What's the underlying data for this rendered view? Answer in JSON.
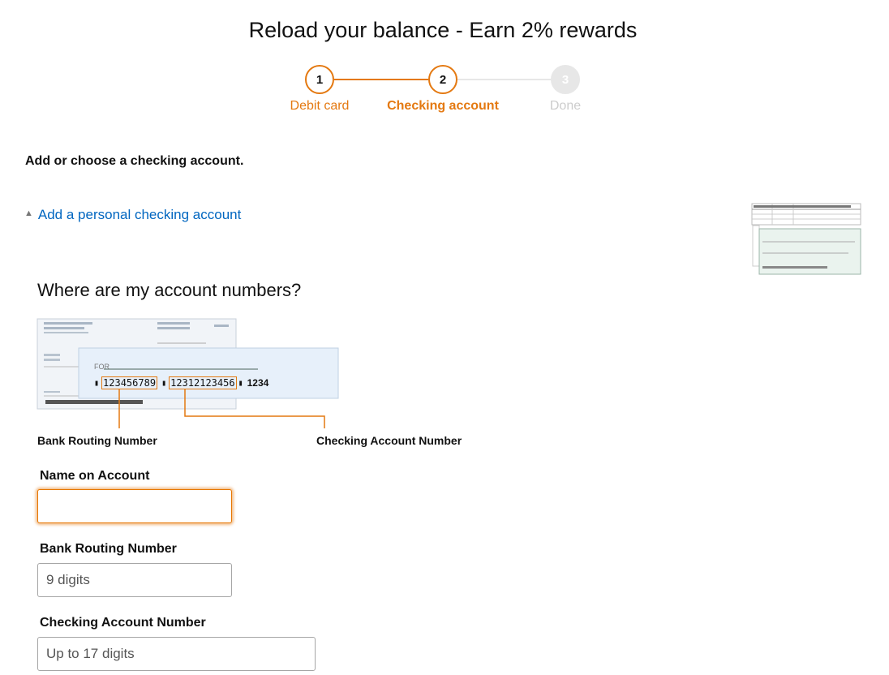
{
  "page_title": "Reload your balance - Earn 2% rewards",
  "stepper": {
    "steps": [
      {
        "number": "1",
        "label": "Debit card",
        "state": "completed"
      },
      {
        "number": "2",
        "label": "Checking account",
        "state": "current"
      },
      {
        "number": "3",
        "label": "Done",
        "state": "upcoming"
      }
    ]
  },
  "section_heading": "Add or choose a checking account.",
  "add_account_link": "Add a personal checking account",
  "where_heading": "Where are my account numbers?",
  "check_illustration": {
    "routing_number": "123456789",
    "account_number": "12312123456",
    "check_number": "1234",
    "routing_caption": "Bank Routing Number",
    "account_caption": "Checking Account Number",
    "memo_label": "FOR"
  },
  "form": {
    "name_label": "Name on Account",
    "name_value": "",
    "routing_label": "Bank Routing Number",
    "routing_placeholder": "9 digits",
    "account_label": "Checking Account Number",
    "account_placeholder": "Up to 17 digits"
  },
  "colors": {
    "accent": "#e47911",
    "link": "#0066c0",
    "inactive_step": "#e7e7e7",
    "inactive_text": "#cccccc"
  }
}
